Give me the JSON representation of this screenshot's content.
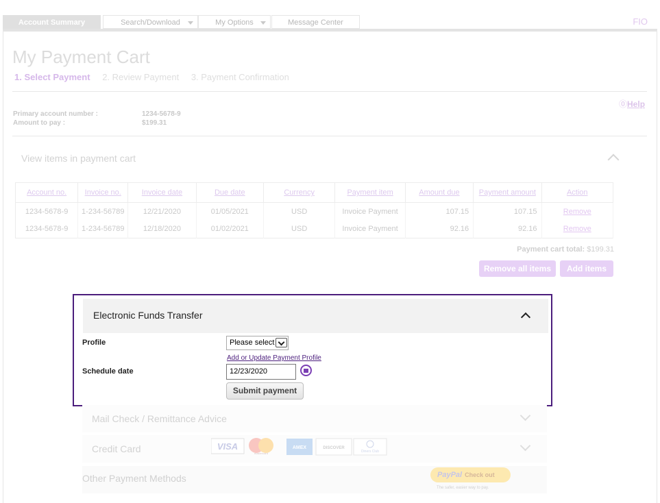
{
  "nav": {
    "tabs": [
      {
        "label": "Account Summary",
        "active": true
      },
      {
        "label": "Search/Download",
        "dropdown": true
      },
      {
        "label": "My Options",
        "dropdown": true
      },
      {
        "label": "Message Center"
      }
    ],
    "user_code": "FIO"
  },
  "page": {
    "title": "My Payment Cart",
    "steps": [
      "1.  Select Payment",
      "2.  Review Payment",
      "3.  Payment Confirmation"
    ],
    "help_label": "Help"
  },
  "account": {
    "primary_label": "Primary account number :",
    "primary_value": "1234-5678-9",
    "amount_label": "Amount to pay :",
    "amount_value": "$199.31"
  },
  "cart": {
    "section_title": "View items in payment cart",
    "columns": [
      "Account no.",
      "Invoice no.",
      "Invoice date",
      "Due date",
      "Currency",
      "Payment item",
      "Amount due",
      "Payment amount",
      "Action"
    ],
    "rows": [
      [
        "1234-5678-9",
        "1-234-56789",
        "12/21/2020",
        "01/05/2021",
        "USD",
        "Invoice Payment",
        "107.15",
        "107.15",
        "Remove"
      ],
      [
        "1234-5678-9",
        "1-234-56789",
        "12/18/2020",
        "01/02/2021",
        "USD",
        "Invoice Payment",
        "92.16",
        "92.16",
        "Remove"
      ]
    ],
    "total_label": "Payment cart total:",
    "total_value": "$199.31",
    "remove_all_label": "Remove all items",
    "add_items_label": "Add items"
  },
  "eft": {
    "title": "Electronic Funds Transfer",
    "profile_label": "Profile",
    "profile_value": "Please select",
    "profile_link": "Add or Update Payment Profile",
    "schedule_label": "Schedule date",
    "schedule_value": "12/23/2020",
    "submit_label": "Submit payment"
  },
  "other_panels": {
    "mail_check": "Mail Check / Remittance Advice",
    "credit_card": "Credit Card",
    "cards": [
      "VISA",
      "mastercard",
      "AMEX",
      "DISCOVER",
      "Diners Club"
    ],
    "other_methods": "Other Payment Methods",
    "paypal_label": "PayPal",
    "paypal_checkout": "Check out",
    "paypal_tagline": "The safer, easier way to pay."
  },
  "colors": {
    "accent": "#4b1d7c",
    "link": "#4b1d7c",
    "faded_purple": "#e7d1f6"
  }
}
